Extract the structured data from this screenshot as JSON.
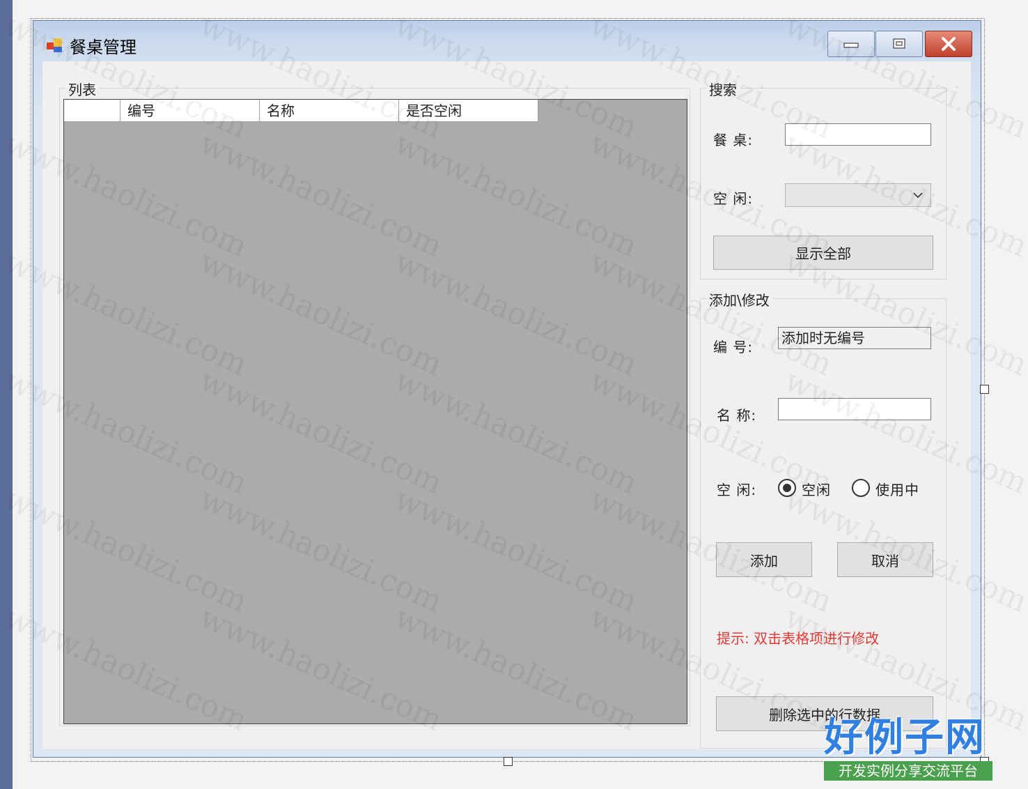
{
  "window": {
    "title": "餐桌管理"
  },
  "list_group": {
    "title": "列表",
    "columns": [
      "",
      "编号",
      "名称",
      "是否空闲"
    ]
  },
  "search_group": {
    "title": "搜索",
    "table_label": "餐  桌:",
    "table_value": "",
    "idle_label": "空  闲:",
    "idle_value": "",
    "show_all_label": "显示全部"
  },
  "edit_group": {
    "title": "添加\\修改",
    "id_label": "编  号:",
    "id_value": "添加时无编号",
    "name_label": "名  称:",
    "name_value": "",
    "idle_label": "空  闲:",
    "radio_idle_label": "空闲",
    "radio_in_use_label": "使用中",
    "radio_selected": "空闲",
    "add_label": "添加",
    "cancel_label": "取消",
    "hint": "提示:  双击表格项进行修改",
    "delete_label": "删除选中的行数据"
  },
  "watermark": {
    "text": "www.haolizi.com",
    "logo_main": "好例子网",
    "logo_sub": "开发实例分享交流平台"
  },
  "colors": {
    "grid_background": "#ababab",
    "hint": "#e53935",
    "close_button": "#c1412d",
    "logo_blue": "#2f80e0",
    "logo_green": "#4aa04c"
  }
}
